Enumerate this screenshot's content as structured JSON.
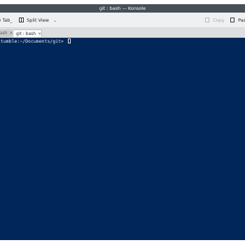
{
  "window": {
    "title": "git : bash — Konsole"
  },
  "toolbar": {
    "new_tab_label": "New Tab",
    "new_tab_visible": "w Tab_",
    "split_view_label": "Split View",
    "copy_label": "Copy",
    "paste_label": "Paste",
    "paste_visible": "Past"
  },
  "tabs": [
    {
      "label": "bash",
      "visible": "ash",
      "active": false
    },
    {
      "label": "git : bash",
      "active": true
    }
  ],
  "terminal": {
    "prompt": "stumble:~/Documents/git> ",
    "background": "#01265a"
  },
  "icons": {
    "split": "split-view-icon",
    "copy": "copy-icon",
    "paste": "paste-icon",
    "close": "close-icon",
    "chevron": "chevron-down-icon"
  }
}
